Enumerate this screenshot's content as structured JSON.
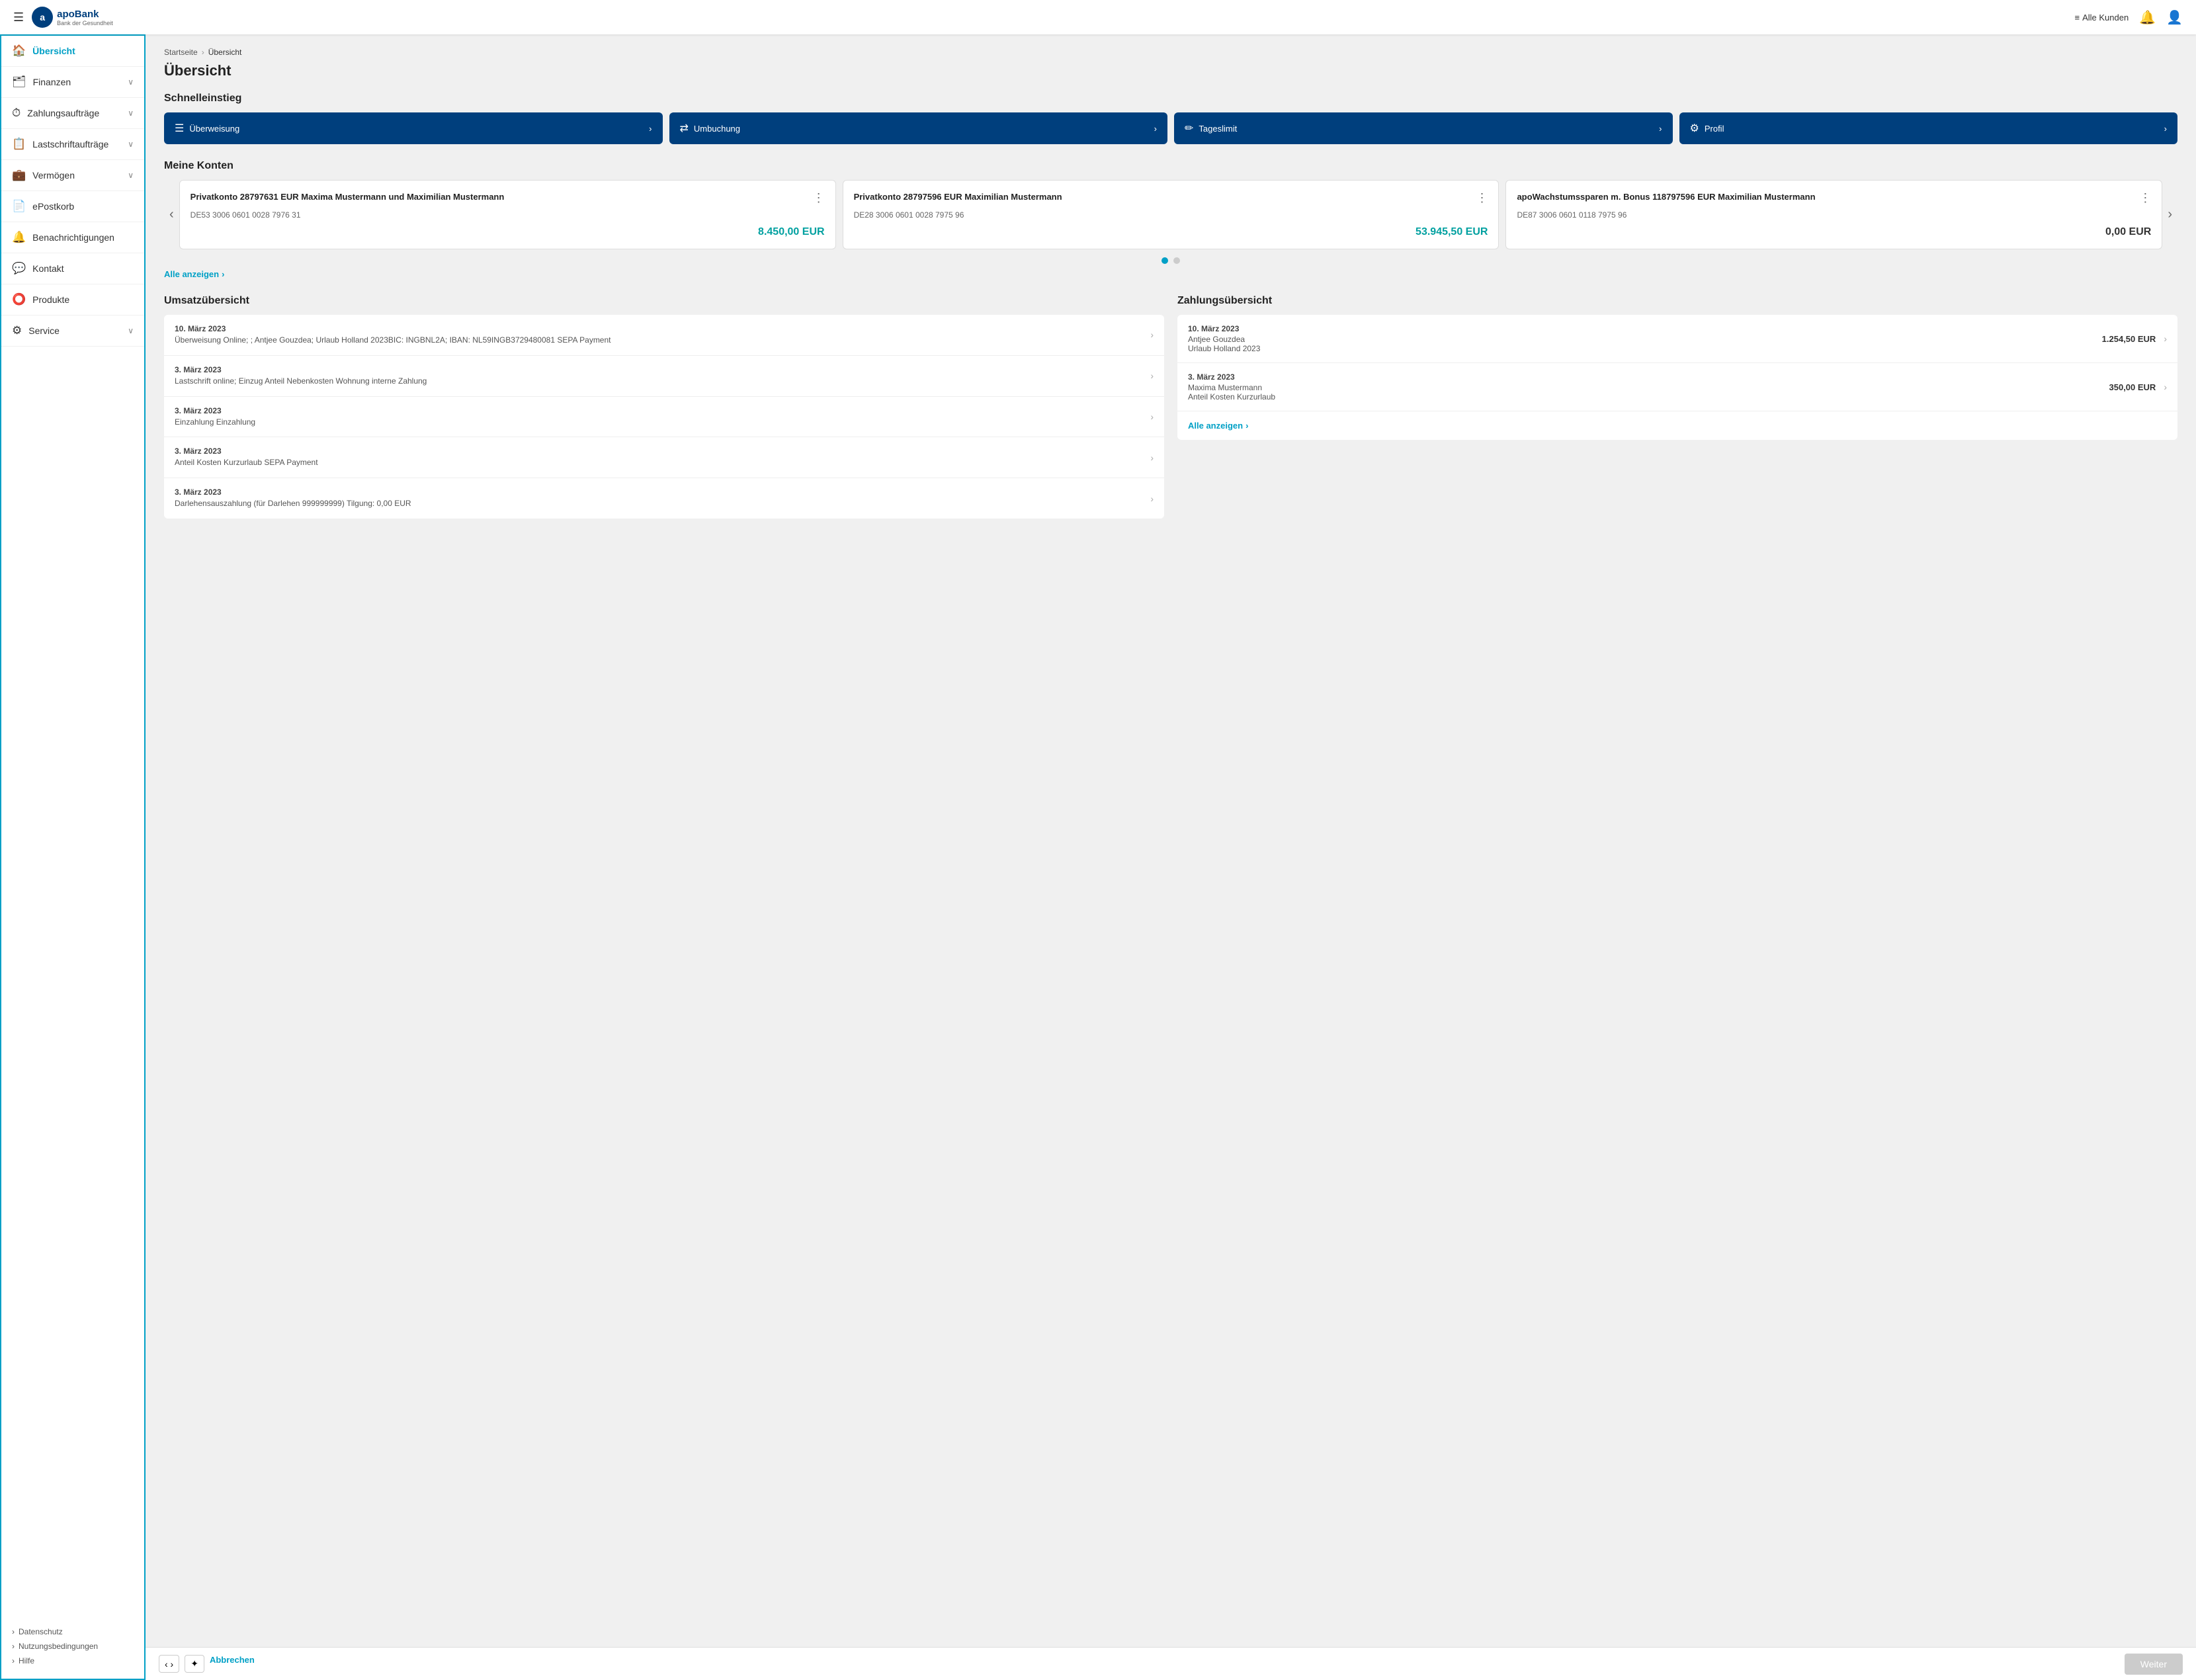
{
  "header": {
    "hamburger_label": "☰",
    "logo_letter": "a",
    "logo_name": "apoBank",
    "logo_subtitle": "Bank der Gesundheit",
    "alle_kunden_label": "Alle Kunden",
    "notification_icon": "🔔",
    "user_icon": "👤"
  },
  "sidebar": {
    "items": [
      {
        "id": "uebersicht",
        "label": "Übersicht",
        "icon": "🏠",
        "active": true,
        "chevron": false
      },
      {
        "id": "finanzen",
        "label": "Finanzen",
        "icon": "🗃",
        "active": false,
        "chevron": true
      },
      {
        "id": "zahlungsauftraege",
        "label": "Zahlungsaufträge",
        "icon": "⏱",
        "active": false,
        "chevron": true
      },
      {
        "id": "lastschriftauftraege",
        "label": "Lastschriftaufträge",
        "icon": "📋",
        "active": false,
        "chevron": true
      },
      {
        "id": "vermoegen",
        "label": "Vermögen",
        "icon": "💼",
        "active": false,
        "chevron": true
      },
      {
        "id": "epostkorb",
        "label": "ePostkorb",
        "icon": "📄",
        "active": false,
        "chevron": false
      },
      {
        "id": "benachrichtigungen",
        "label": "Benachrichtigungen",
        "icon": "🔔",
        "active": false,
        "chevron": false
      },
      {
        "id": "kontakt",
        "label": "Kontakt",
        "icon": "💬",
        "active": false,
        "chevron": false
      },
      {
        "id": "produkte",
        "label": "Produkte",
        "icon": "⭕",
        "active": false,
        "chevron": false
      },
      {
        "id": "service",
        "label": "Service",
        "icon": "⚙",
        "active": false,
        "chevron": true
      }
    ],
    "footer_items": [
      {
        "id": "datenschutz",
        "label": "Datenschutz"
      },
      {
        "id": "nutzungsbedingungen",
        "label": "Nutzungsbedingungen"
      },
      {
        "id": "hilfe",
        "label": "Hilfe"
      }
    ]
  },
  "breadcrumb": {
    "home": "Startseite",
    "sep": "›",
    "current": "Übersicht"
  },
  "page_title": "Übersicht",
  "schnelleinstieg": {
    "title": "Schnelleinstieg",
    "buttons": [
      {
        "id": "ueberweisung",
        "icon": "☰",
        "label": "Überweisung"
      },
      {
        "id": "umbuchung",
        "icon": "⇄",
        "label": "Umbuchung"
      },
      {
        "id": "tageslimit",
        "icon": "✏",
        "label": "Tageslimit"
      },
      {
        "id": "profil",
        "icon": "⚙",
        "label": "Profil"
      }
    ]
  },
  "meine_konten": {
    "title": "Meine Konten",
    "cards": [
      {
        "id": "konto1",
        "title": "Privatkonto 28797631 EUR Maxima Mustermann und Maximilian Mustermann",
        "iban": "DE53 3006 0601 0028 7976 31",
        "balance": "8.450,00 EUR",
        "balance_zero": false
      },
      {
        "id": "konto2",
        "title": "Privatkonto 28797596 EUR Maximilian Mustermann",
        "iban": "DE28 3006 0601 0028 7975 96",
        "balance": "53.945,50 EUR",
        "balance_zero": false
      },
      {
        "id": "konto3",
        "title": "apoWachstumssparen m. Bonus 118797596 EUR Maximilian Mustermann",
        "iban": "DE87 3006 0601 0118 7975 96",
        "balance": "0,00 EUR",
        "balance_zero": true
      }
    ],
    "dots": [
      true,
      false
    ],
    "alle_anzeigen": "Alle anzeigen"
  },
  "umsatz": {
    "title": "Umsatzübersicht",
    "items": [
      {
        "date": "10. März 2023",
        "desc": "Überweisung Online; ; Antjee Gouzdea; Urlaub Holland 2023BIC: INGBNL2A; IBAN: NL59INGB3729480081\nSEPA Payment"
      },
      {
        "date": "3. März 2023",
        "desc": "Lastschrift online; Einzug Anteil Nebenkosten Wohnung\ninterne Zahlung"
      },
      {
        "date": "3. März 2023",
        "desc": "Einzahlung\nEinzahlung"
      },
      {
        "date": "3. März 2023",
        "desc": "Anteil Kosten Kurzurlaub\nSEPA Payment"
      },
      {
        "date": "3. März 2023",
        "desc": "Darlehensauszahlung (für Darlehen 999999999) Tilgung: 0,00 EUR"
      }
    ]
  },
  "zahlung": {
    "title": "Zahlungsübersicht",
    "items": [
      {
        "date": "10. März 2023",
        "name": "Antjee Gouzdea",
        "purpose": "Urlaub Holland 2023",
        "amount": "1.254,50 EUR"
      },
      {
        "date": "3. März 2023",
        "name": "Maxima Mustermann",
        "purpose": "Anteil Kosten Kurzurlaub",
        "amount": "350,00 EUR"
      }
    ],
    "alle_anzeigen": "Alle anzeigen"
  },
  "bottom_bar": {
    "left_icon1": "‹ ›",
    "left_icon2": "✦",
    "abbrechen": "Abbrechen",
    "weiter": "Weiter"
  }
}
